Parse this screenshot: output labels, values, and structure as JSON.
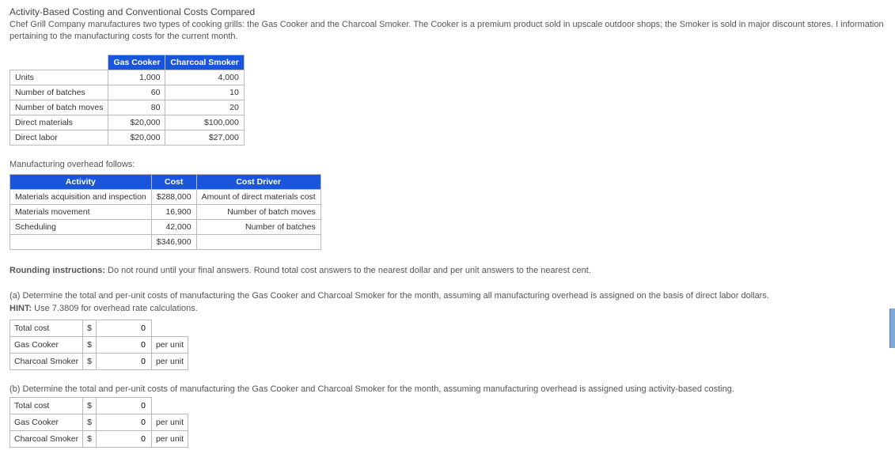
{
  "title": "Activity-Based Costing and Conventional Costs Compared",
  "description": "Chef Grill Company manufactures two types of cooking grills: the Gas Cooker and the Charcoal Smoker. The Cooker is a premium product sold in upscale outdoor shops; the Smoker is sold in major discount stores. I information pertaining to the manufacturing costs for the current month.",
  "products_table": {
    "headers": [
      "",
      "Gas Cooker",
      "Charcoal Smoker"
    ],
    "rows": [
      {
        "label": "Units",
        "gas": "1,000",
        "smoker": "4,000"
      },
      {
        "label": "Number of batches",
        "gas": "60",
        "smoker": "10"
      },
      {
        "label": "Number of batch moves",
        "gas": "80",
        "smoker": "20"
      },
      {
        "label": "Direct materials",
        "gas": "$20,000",
        "smoker": "$100,000"
      },
      {
        "label": "Direct labor",
        "gas": "$20,000",
        "smoker": "$27,000"
      }
    ]
  },
  "overhead_label": "Manufacturing overhead follows:",
  "overhead_table": {
    "headers": [
      "Activity",
      "Cost",
      "Cost Driver"
    ],
    "rows": [
      {
        "activity": "Materials acquisition and inspection",
        "cost": "$288,000",
        "driver": "Amount of direct materials cost"
      },
      {
        "activity": "Materials movement",
        "cost": "16,900",
        "driver": "Number of batch moves"
      },
      {
        "activity": "Scheduling",
        "cost": "42,000",
        "driver": "Number of batches"
      }
    ],
    "total": "$346,900"
  },
  "rounding_label": "Rounding instructions:",
  "rounding_text": " Do not round until your final answers. Round total cost answers to the nearest dollar and per unit answers to the nearest cent.",
  "part_a": {
    "question": "(a) Determine the total and per-unit costs of manufacturing the Gas Cooker and Charcoal Smoker for the month, assuming all manufacturing overhead is assigned on the basis of direct labor dollars.",
    "hint_label": "HINT:",
    "hint_text": " Use 7.3809 for overhead rate calculations."
  },
  "part_b": {
    "question": "(b) Determine the total and per-unit costs of manufacturing the Gas Cooker and Charcoal Smoker for the month, assuming manufacturing overhead is assigned using activity-based costing."
  },
  "answer_rows": {
    "total": "Total cost",
    "gas": "Gas Cooker",
    "smoker": "Charcoal Smoker",
    "currency": "$",
    "zero": "0",
    "per_unit": "per unit"
  }
}
